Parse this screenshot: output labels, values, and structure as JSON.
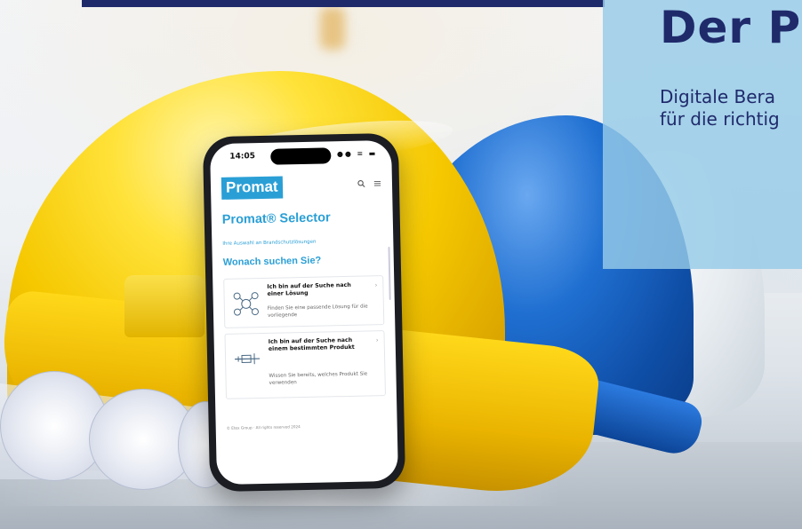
{
  "phone": {
    "status_time": "14:05",
    "status_icons": "●● ≡ ▬",
    "app": {
      "logo": "Promat",
      "search_icon": "search-icon",
      "menu_icon": "menu-icon",
      "title": "Promat® Selector",
      "subtitle": "Ihre Auswahl an Brandschutzlösungen",
      "question": "Wonach suchen Sie?",
      "cards": [
        {
          "title": "Ich bin auf der Suche nach einer Lösung",
          "description": "Finden Sie eine passende Lösung für die vorliegende",
          "icon": "network-icon"
        },
        {
          "title": "Ich bin auf der Suche nach einem bestimmten Produkt",
          "description": "Wissen Sie bereits, welches Produkt Sie verwenden",
          "icon": "tool-icon"
        }
      ],
      "footer": "© Etex Group · All rights reserved 2024"
    }
  },
  "panel": {
    "headline": "Der P",
    "line_1": "Digitale Bera",
    "line_2": "für die richtig"
  },
  "colors": {
    "brand_blue": "#2a9fd6",
    "navy": "#1f2a6b",
    "panel_bg": "#96cae8"
  }
}
